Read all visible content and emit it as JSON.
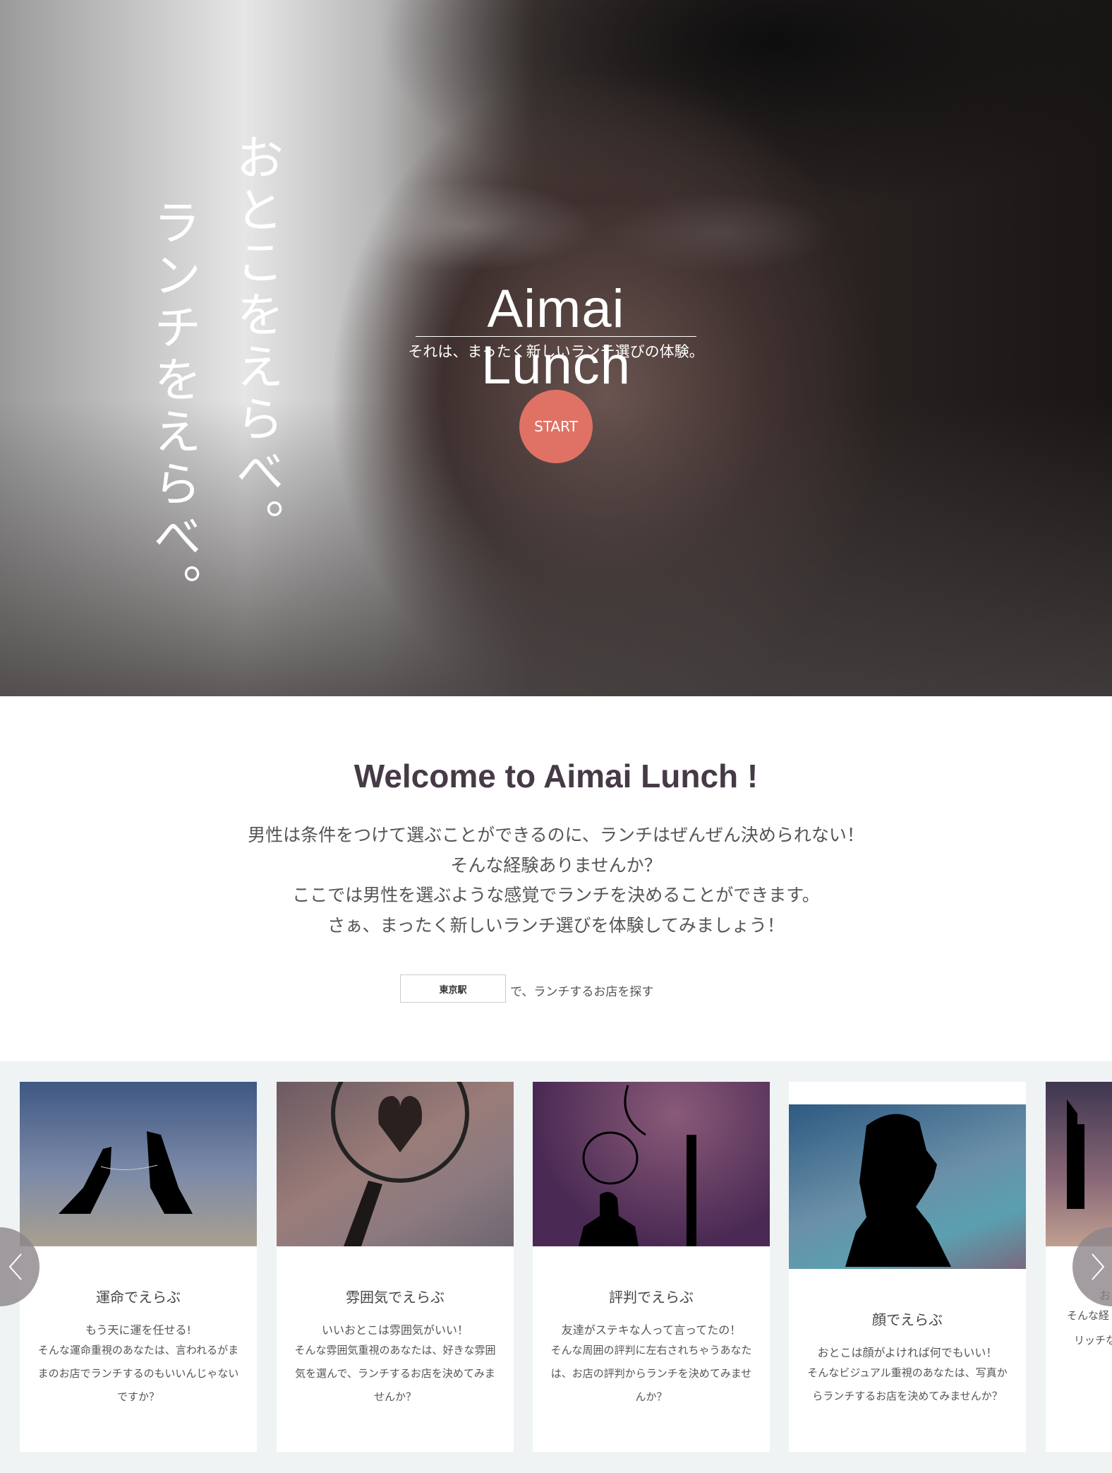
{
  "hero": {
    "vertical_lines": [
      "おとこをえらべ。",
      "ランチをえらべ。"
    ],
    "logo": "Aimai Lunch",
    "tagline": "それは、まったく新しいランチ選びの体験。",
    "start_label": "START",
    "accent": "#e07265"
  },
  "welcome": {
    "title_prefix": "Welcome to ",
    "title_brand": "Aimai Lunch !",
    "lines": [
      "男性は条件をつけて選ぶことができるのに、ランチはぜんぜん決められない！",
      "そんな経験ありませんか？",
      "ここでは男性を選ぶような感覚でランチを決めることができます。",
      "さぁ、まったく新しいランチ選びを体験してみましょう！"
    ],
    "search_value": "東京駅",
    "search_suffix": "で、ランチするお店を探す"
  },
  "cards": [
    {
      "title": "運命でえらぶ",
      "lead": "もう天に運を任せる!",
      "desc": "そんな運命重視のあなたは、言われるがままのお店でランチするのもいいんじゃないですか？",
      "icon": "hands-icon"
    },
    {
      "title": "雰囲気でえらぶ",
      "lead": "いいおとこは雰囲気がいい！",
      "desc": "そんな雰囲気重視のあなたは、好きな雰囲気を選んで、ランチするお店を決めてみませんか？",
      "icon": "magnifier-heart-icon"
    },
    {
      "title": "評判でえらぶ",
      "lead": "友達がステキな人って言ってたの！",
      "desc": "そんな周囲の評判に左右されちゃうあなたは、お店の評判からランチを決めてみませんか？",
      "icon": "speech-bubble-icon"
    },
    {
      "title": "顔でえらぶ",
      "lead": "おとこは顔がよければ何でもいい！",
      "desc": "そんなビジュアル重視のあなたは、写真からランチするお店を決めてみませんか？",
      "icon": "face-silhouette-icon"
    },
    {
      "title": "",
      "lead": "お",
      "desc": "そんな経",
      "desc2": "リッチな",
      "icon": "building-icon"
    }
  ],
  "carousel": {
    "prev_icon": "chevron-left-icon",
    "next_icon": "chevron-right-icon"
  }
}
